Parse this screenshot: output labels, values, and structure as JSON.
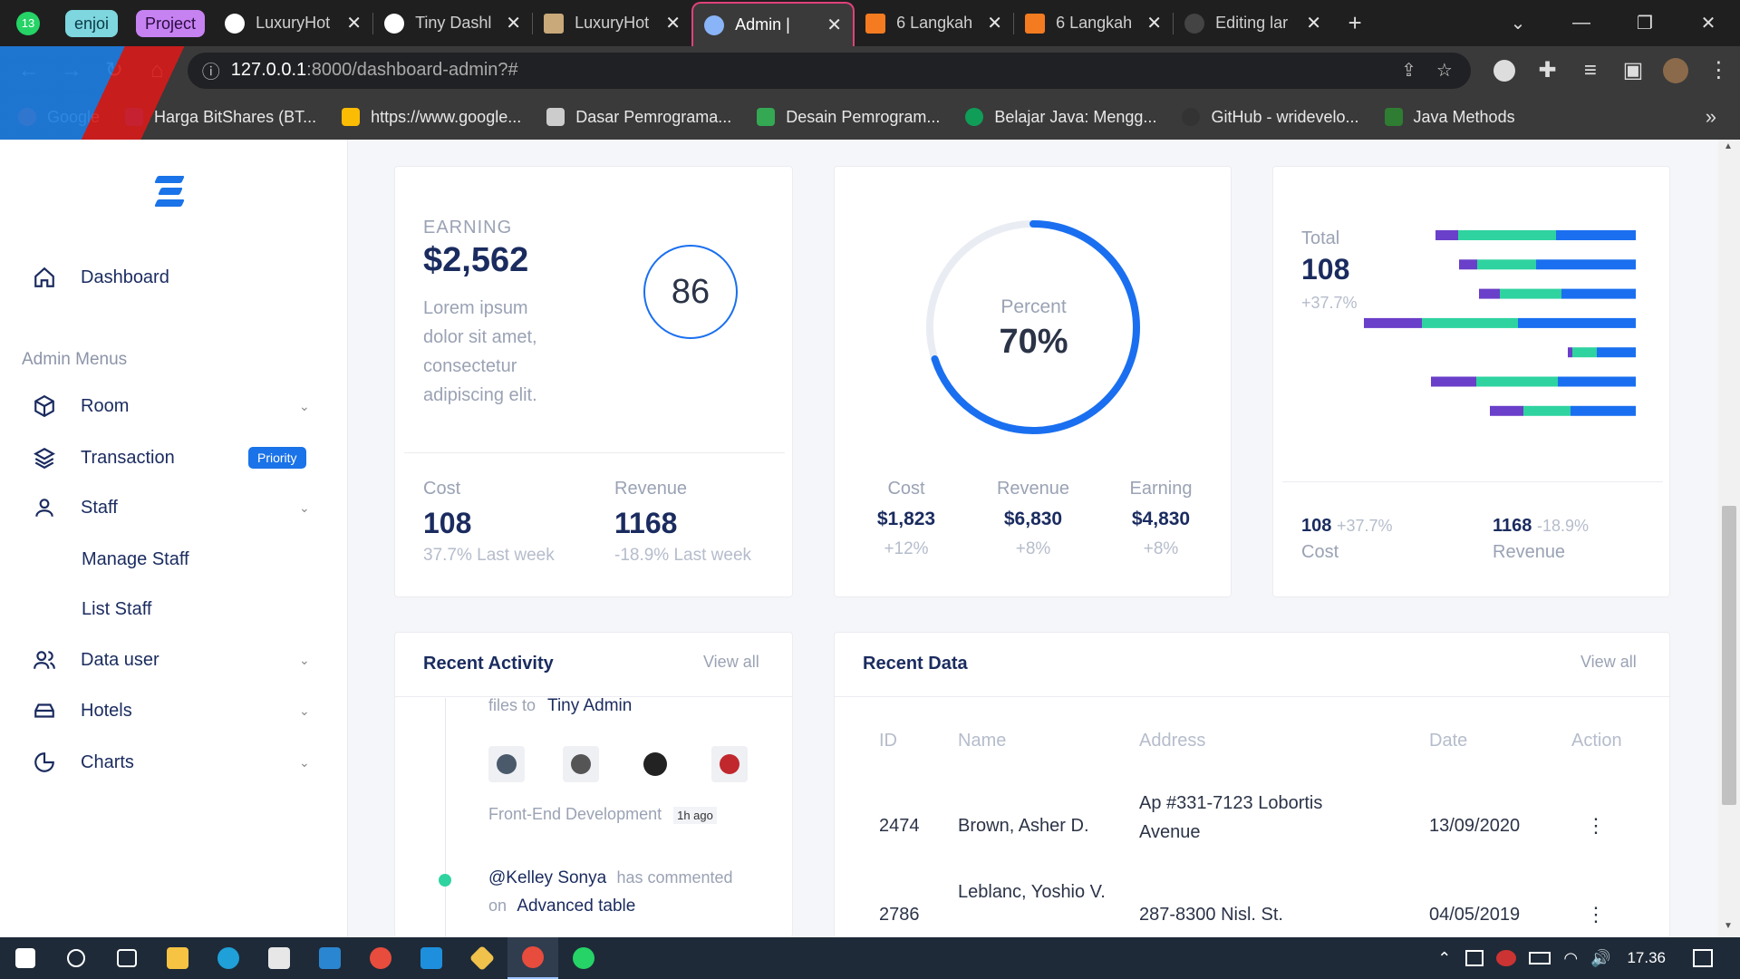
{
  "browser": {
    "tabs": [
      {
        "label": "enjoi",
        "type": "group",
        "color": "#7ed6df"
      },
      {
        "label": "Project",
        "type": "group",
        "color": "#c782f2"
      },
      {
        "label": "LuxuryHot",
        "icon": "globe-icon"
      },
      {
        "label": "Tiny Dashl",
        "icon": "globe-icon"
      },
      {
        "label": "LuxuryHot",
        "icon": "page-icon"
      },
      {
        "label": "Admin |",
        "icon": "admin-icon",
        "active": true
      },
      {
        "label": "6 Langkah",
        "icon": "jh-icon"
      },
      {
        "label": "6 Langkah",
        "icon": "jh-icon"
      },
      {
        "label": "Editing lar",
        "icon": "github-icon"
      }
    ],
    "whatsapp_badge": "13",
    "new_tab": "+",
    "url_host": "127.0.0.1",
    "url_path": ":8000/dashboard-admin?#",
    "bookmarks": [
      {
        "label": "Google",
        "color": "#ea4335"
      },
      {
        "label": "Harga BitShares (BT...",
        "color": "#2962ff"
      },
      {
        "label": "https://www.google...",
        "color": "#fbbc04"
      },
      {
        "label": "Dasar Pemrograma...",
        "color": "#cccccc"
      },
      {
        "label": "Desain Pemrogram...",
        "color": "#34a853"
      },
      {
        "label": "Belajar Java: Mengg...",
        "color": "#0f9d58"
      },
      {
        "label": "GitHub - wridevelo...",
        "color": "#333333"
      },
      {
        "label": "Java Methods",
        "color": "#2e7d32"
      }
    ],
    "more_bookmarks": "»"
  },
  "sidebar": {
    "dashboard": "Dashboard",
    "menu_heading": "Admin Menus",
    "items": {
      "room": "Room",
      "transaction": "Transaction",
      "transaction_badge": "Priority",
      "staff": "Staff",
      "manage_staff": "Manage Staff",
      "list_staff": "List Staff",
      "data_user": "Data user",
      "hotels": "Hotels",
      "charts": "Charts"
    }
  },
  "earning_card": {
    "label": "EARNING",
    "amount": "$2,562",
    "description": "Lorem ipsum dolor sit amet, consectetur adipiscing elit.",
    "circle_value": "86",
    "cost_label": "Cost",
    "cost_value": "108",
    "cost_sub": "37.7% Last week",
    "revenue_label": "Revenue",
    "revenue_value": "1168",
    "revenue_sub": "-18.9% Last week"
  },
  "percent_card": {
    "label": "Percent",
    "value": "70%",
    "progress": 0.7,
    "stats": [
      {
        "label": "Cost",
        "value": "$1,823",
        "change": "+12%"
      },
      {
        "label": "Revenue",
        "value": "$6,830",
        "change": "+8%"
      },
      {
        "label": "Earning",
        "value": "$4,830",
        "change": "+8%"
      }
    ]
  },
  "total_card": {
    "label": "Total",
    "value": "108",
    "change": "+37.7%",
    "cost_value": "108",
    "cost_change": "+37.7%",
    "cost_label": "Cost",
    "revenue_value": "1168",
    "revenue_change": "-18.9%",
    "revenue_label": "Revenue"
  },
  "chart_data": {
    "type": "bar",
    "stacked": true,
    "orientation": "horizontal",
    "colors": [
      "#6a3fc9",
      "#2fd3a0",
      "#1a6ff0"
    ],
    "series": [
      {
        "values": [
          25,
          20,
          23,
          67,
          5,
          50,
          37
        ]
      },
      {
        "values": [
          108,
          65,
          68,
          106,
          27,
          90,
          52
        ]
      },
      {
        "values": [
          88,
          110,
          82,
          130,
          43,
          86,
          72
        ]
      }
    ],
    "xlim": [
      0,
      300
    ]
  },
  "activity": {
    "title": "Recent Activity",
    "view_all": "View all",
    "item1_prefix": "files to",
    "item1_target": "Tiny Admin",
    "item1_meta": "Front-End Development",
    "item1_time": "1h ago",
    "item2_user": "@Kelley Sonya",
    "item2_action": "has commented",
    "item2_on": "on",
    "item2_target": "Advanced table"
  },
  "recent_data": {
    "title": "Recent Data",
    "view_all": "View all",
    "columns": [
      "ID",
      "Name",
      "Address",
      "Date",
      "Action"
    ],
    "rows": [
      {
        "id": "2474",
        "name": "Brown, Asher D.",
        "address": "Ap #331-7123 Lobortis Avenue",
        "date": "13/09/2020",
        "action": "⋮"
      },
      {
        "id": "2786",
        "name": "Leblanc, Yoshio V.",
        "address": "287-8300 Nisl. St.",
        "date": "04/05/2019",
        "action": "⋮"
      }
    ]
  },
  "taskbar": {
    "time": "17.36"
  }
}
